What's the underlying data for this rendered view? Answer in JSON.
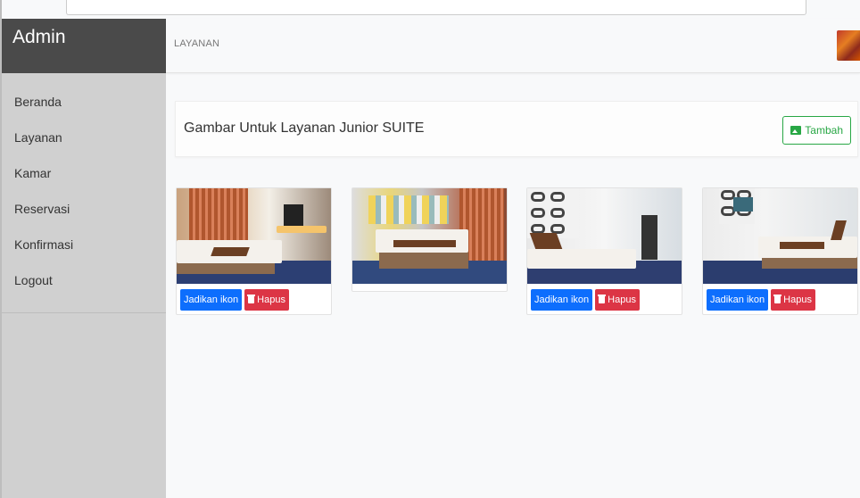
{
  "sidebar": {
    "brand": "Admin",
    "items": [
      {
        "label": "Beranda"
      },
      {
        "label": "Layanan"
      },
      {
        "label": "Kamar"
      },
      {
        "label": "Reservasi"
      },
      {
        "label": "Konfirmasi"
      },
      {
        "label": "Logout"
      }
    ]
  },
  "header": {
    "breadcrumb": "LAYANAN"
  },
  "content": {
    "title": "Gambar Untuk Layanan Junior SUITE",
    "add_button": "Tambah"
  },
  "cards": [
    {
      "set_icon": "Jadikan ikon",
      "delete": "Hapus"
    },
    {},
    {
      "set_icon": "Jadikan ikon",
      "delete": "Hapus"
    },
    {
      "set_icon": "Jadikan ikon",
      "delete": "Hapus"
    }
  ],
  "colors": {
    "sidebar_bg": "#d0d0d0",
    "brand_bg": "#4a4a4a",
    "primary": "#0d6efd",
    "danger": "#dc3545",
    "success": "#28a745"
  },
  "icons": {
    "add": "image-icon",
    "delete": "trash-icon"
  }
}
